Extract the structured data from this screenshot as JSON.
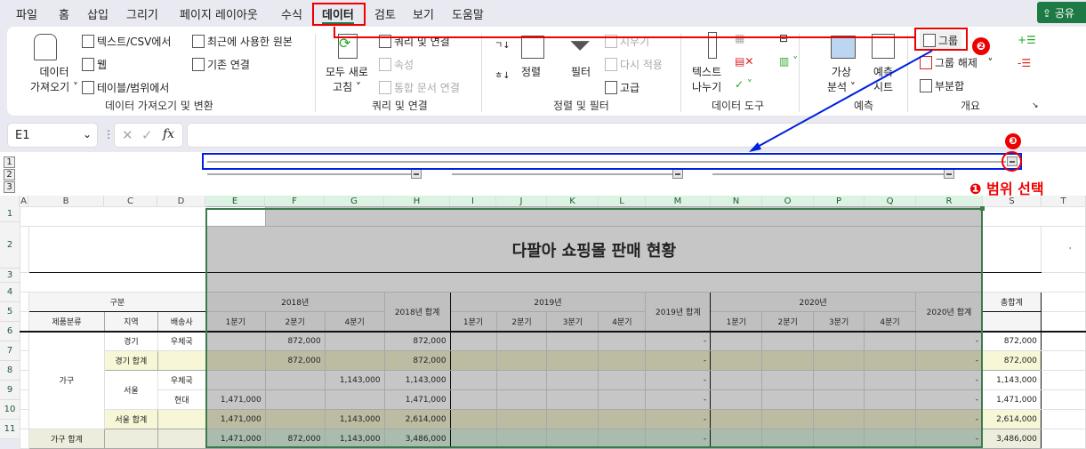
{
  "tabs": [
    "파일",
    "홈",
    "삽입",
    "그리기",
    "페이지 레이아웃",
    "수식",
    "데이터",
    "검토",
    "보기",
    "도움말"
  ],
  "share": "공유",
  "ribbon": {
    "get_data": "데이터",
    "get_data2": "가져오기",
    "from_text": "텍스트/CSV에서",
    "web": "웹",
    "from_table": "테이블/범위에서",
    "recent": "최근에 사용한 원본",
    "existing": "기존 연결",
    "group1": "데이터 가져오기 및 변환",
    "refresh": "모두 새로",
    "refresh2": "고침",
    "queries": "쿼리 및 연결",
    "properties": "속성",
    "edit_links": "통합 문서 연결",
    "group2": "쿼리 및 연결",
    "sort": "정렬",
    "filter": "필터",
    "clear": "지우기",
    "reapply": "다시 적용",
    "advanced": "고급",
    "group3": "정렬 및 필터",
    "text_to_col": "텍스트",
    "text_to_col2": "나누기",
    "group4": "데이터 도구",
    "whatif": "가상",
    "whatif2": "분석",
    "forecast": "예측",
    "forecast2": "시트",
    "group5": "예측",
    "group_btn": "그룹",
    "ungroup": "그룹 해제",
    "subtotal": "부분합",
    "group6": "개요"
  },
  "formula": {
    "namebox": "E1",
    "fx": "fx",
    "value": ""
  },
  "annotations": {
    "n1": "❶ 범위 선택",
    "n2": "❷",
    "n3": "❸"
  },
  "outline_levels": [
    "1",
    "2",
    "3"
  ],
  "columns": [
    "A",
    "B",
    "C",
    "D",
    "E",
    "F",
    "G",
    "H",
    "I",
    "J",
    "K",
    "L",
    "M",
    "N",
    "O",
    "P",
    "Q",
    "R",
    "S",
    "T"
  ],
  "rows": [
    "1",
    "2",
    "3",
    "4",
    "5",
    "6",
    "7",
    "8",
    "9",
    "10",
    "11"
  ],
  "sheet": {
    "title": "다팔아 쇼핑몰 판매 현황",
    "h_category": "구분",
    "h_2018": "2018년",
    "h_2018t": "2018년 합계",
    "h_2019": "2019년",
    "h_2019t": "2019년 합계",
    "h_2020": "2020년",
    "h_2020t": "2020년 합계",
    "h_total": "총합계",
    "h_prod": "제품분류",
    "h_region": "지역",
    "h_ship": "배송사",
    "q2018": [
      "1분기",
      "2분기",
      "4분기"
    ],
    "q2019": [
      "1분기",
      "2분기",
      "3분기",
      "4분기"
    ],
    "q2020": [
      "1분기",
      "2분기",
      "3분기",
      "4분기"
    ],
    "furniture": "가구",
    "gyeonggi": "경기",
    "gyeonggi_total": "경기 합계",
    "seoul": "서울",
    "seoul_total": "서울 합계",
    "furniture_total": "가구 합계",
    "post": "우체국",
    "hyundai": "현대",
    "data": [
      {
        "e": "",
        "f": "872,000",
        "g": "",
        "h": "872,000",
        "m": "-",
        "r": "-",
        "s": "872,000"
      },
      {
        "e": "",
        "f": "872,000",
        "g": "",
        "h": "872,000",
        "m": "-",
        "r": "-",
        "s": "872,000"
      },
      {
        "e": "",
        "f": "",
        "g": "1,143,000",
        "h": "1,143,000",
        "m": "-",
        "r": "-",
        "s": "1,143,000"
      },
      {
        "e": "1,471,000",
        "f": "",
        "g": "",
        "h": "1,471,000",
        "m": "-",
        "r": "-",
        "s": "1,471,000"
      },
      {
        "e": "1,471,000",
        "f": "",
        "g": "1,143,000",
        "h": "2,614,000",
        "m": "-",
        "r": "-",
        "s": "2,614,000"
      },
      {
        "e": "1,471,000",
        "f": "872,000",
        "g": "1,143,000",
        "h": "3,486,000",
        "m": "-",
        "r": "-",
        "s": "3,486,000"
      }
    ]
  },
  "colors": {
    "accent": "#1e7a45",
    "annotation_red": "#e00000",
    "annotation_blue": "#0020e0"
  }
}
